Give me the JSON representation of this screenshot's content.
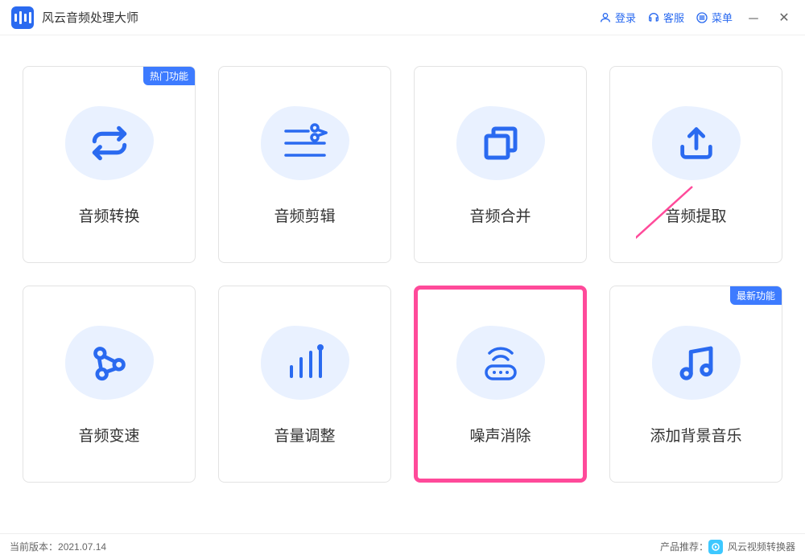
{
  "titlebar": {
    "app_name": "风云音频处理大师",
    "login": "登录",
    "support": "客服",
    "menu": "菜单"
  },
  "badges": {
    "hot": "热门功能",
    "new": "最新功能"
  },
  "cards": [
    {
      "label": "音频转换",
      "badge": "hot"
    },
    {
      "label": "音频剪辑"
    },
    {
      "label": "音频合并"
    },
    {
      "label": "音频提取"
    },
    {
      "label": "音频变速"
    },
    {
      "label": "音量调整"
    },
    {
      "label": "噪声消除",
      "highlighted": true
    },
    {
      "label": "添加背景音乐",
      "badge": "new"
    }
  ],
  "footer": {
    "version_label": "当前版本：",
    "version": "2021.07.14",
    "recommend_label": "产品推荐：",
    "recommend_product": "风云视频转换器"
  }
}
